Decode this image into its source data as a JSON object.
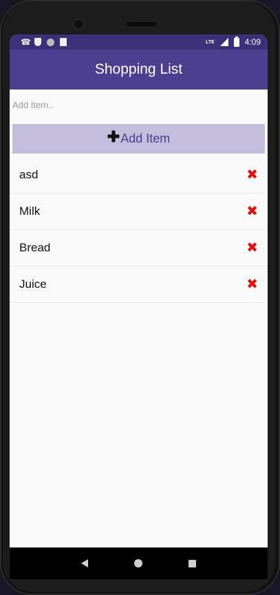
{
  "status_bar": {
    "time": "4:09",
    "network_label": "LTE",
    "icons": [
      "call-forward-icon",
      "shield-icon",
      "circle-icon",
      "sd-card-icon",
      "signal-icon",
      "battery-icon"
    ]
  },
  "app_bar": {
    "title": "Shopping List"
  },
  "input": {
    "placeholder": "Add Item..",
    "value": ""
  },
  "add_button": {
    "icon": "plus-icon",
    "label": "Add Item"
  },
  "items": [
    {
      "label": "asd"
    },
    {
      "label": "Milk"
    },
    {
      "label": "Bread"
    },
    {
      "label": "Juice"
    }
  ],
  "colors": {
    "app_bar": "#4c3f8f",
    "status_bar": "#3a3178",
    "add_button_bg": "#c5bddc",
    "delete": "#e01010"
  }
}
